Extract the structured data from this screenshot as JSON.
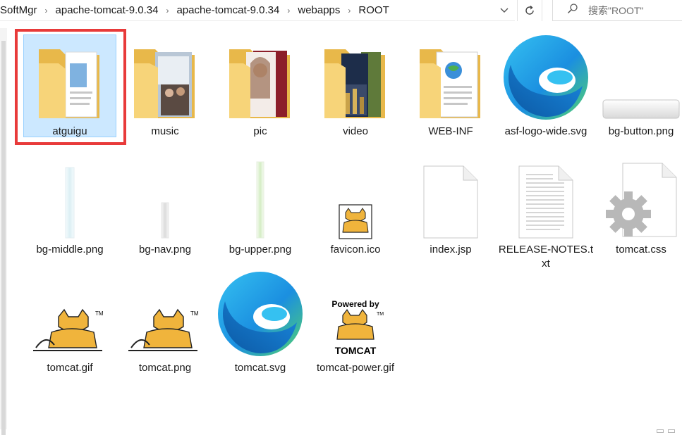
{
  "breadcrumb": {
    "items": [
      "SoftMgr",
      "apache-tomcat-9.0.34",
      "apache-tomcat-9.0.34",
      "webapps",
      "ROOT"
    ],
    "separator": "›"
  },
  "toolbar": {
    "dropdown_icon": "chevron-down-icon",
    "refresh_icon": "refresh-icon"
  },
  "search": {
    "placeholder": "搜索\"ROOT\"",
    "icon": "search-icon"
  },
  "files": [
    {
      "name": "atguigu",
      "type": "folder",
      "selected": true
    },
    {
      "name": "music",
      "type": "folder"
    },
    {
      "name": "pic",
      "type": "folder"
    },
    {
      "name": "video",
      "type": "folder"
    },
    {
      "name": "WEB-INF",
      "type": "folder"
    },
    {
      "name": "asf-logo-wide.svg",
      "type": "edge-svg"
    },
    {
      "name": "bg-button.png",
      "type": "image"
    },
    {
      "name": "bg-middle.png",
      "type": "image"
    },
    {
      "name": "bg-nav.png",
      "type": "image"
    },
    {
      "name": "bg-upper.png",
      "type": "image"
    },
    {
      "name": "favicon.ico",
      "type": "tomcat-icon"
    },
    {
      "name": "index.jsp",
      "type": "document"
    },
    {
      "name": "RELEASE-NOTES.txt",
      "type": "text"
    },
    {
      "name": "tomcat.css",
      "type": "css"
    },
    {
      "name": "tomcat.gif",
      "type": "tomcat-image"
    },
    {
      "name": "tomcat.png",
      "type": "tomcat-image"
    },
    {
      "name": "tomcat.svg",
      "type": "edge-svg"
    },
    {
      "name": "tomcat-power.gif",
      "type": "tomcat-power"
    }
  ],
  "powered_by_text": "Powered by",
  "tomcat_text": "TOMCAT",
  "tm_text": "TM",
  "colors": {
    "selection": "#cce8ff",
    "highlight_box": "#e83a3a",
    "folder": "#f2c94c"
  }
}
